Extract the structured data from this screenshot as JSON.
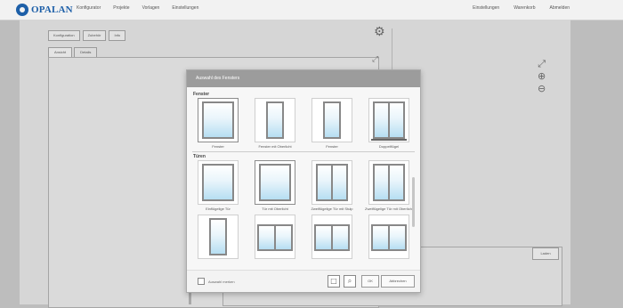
{
  "app": {
    "logo_text": "OPALAN",
    "logo_sub": "",
    "nav": [
      "Konfigurator",
      "Projekte",
      "Vorlagen",
      "Einstellungen"
    ],
    "nav_right": [
      "Einstellungen",
      "Warenkorb",
      "Abmelden"
    ]
  },
  "toolbar": {
    "buttons": [
      "Konfiguration",
      "Zubehör",
      "Info"
    ]
  },
  "tabs": [
    "Ansicht",
    "Details"
  ],
  "tools": {
    "gear_icon": "gear-icon",
    "expand_icon": "expand-icon",
    "zoom_in_icon": "zoom-in-icon",
    "zoom_out_icon": "zoom-out-icon"
  },
  "bottom_panel": {
    "button_label": "Laden"
  },
  "modal": {
    "title": "Auswahl des Fensters",
    "section1_label": "Fenster",
    "section1_items": [
      {
        "label": "Fenster"
      },
      {
        "label": "Fenster mit Oberlicht"
      },
      {
        "label": "Fenster"
      },
      {
        "label": "Doppelflügel"
      }
    ],
    "section2_label": "Türen",
    "section2_items": [
      {
        "label": "Einflügelige Tür"
      },
      {
        "label": "Tür mit Oberlicht"
      },
      {
        "label": "Zweiflügelige Tür mit Stulp"
      },
      {
        "label": "Zweiflügelige Tür mit Oberlicht"
      }
    ],
    "section3_items": [
      {
        "label": ""
      },
      {
        "label": ""
      },
      {
        "label": ""
      },
      {
        "label": ""
      }
    ],
    "footer": {
      "checkbox_label": "Auswahl merken",
      "ok_label": "OK",
      "cancel_label": "Abbrechen"
    }
  },
  "colors": {
    "brand": "#1d5fa8",
    "overlay": "#bdbdbd",
    "modal_header": "#9c9c9c",
    "glass": "#b6def2"
  }
}
